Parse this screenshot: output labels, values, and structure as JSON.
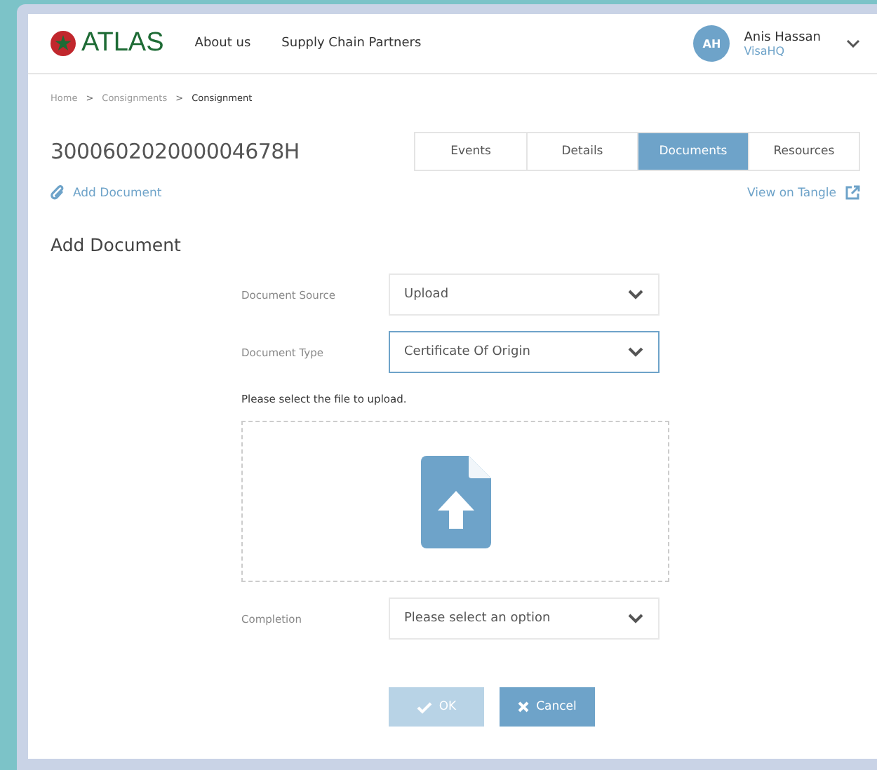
{
  "header": {
    "logo": "ATLAS",
    "nav": [
      "About us",
      "Supply Chain Partners"
    ],
    "user": {
      "initials": "AH",
      "name": "Anis Hassan",
      "org": "VisaHQ"
    }
  },
  "breadcrumb": [
    {
      "label": "Home",
      "current": false
    },
    {
      "label": "Consignments",
      "current": false
    },
    {
      "label": "Consignment",
      "current": true
    }
  ],
  "breadcrumb_separator": ">",
  "consignment_id": "300060202000004678H",
  "tabs": [
    {
      "label": "Events",
      "selected": false
    },
    {
      "label": "Details",
      "selected": false
    },
    {
      "label": "Documents",
      "selected": true
    },
    {
      "label": "Resources",
      "selected": false
    }
  ],
  "add_document_link": "Add Document",
  "tangle_link": "View on Tangle",
  "form": {
    "title": "Add Document",
    "fields": [
      {
        "label": "Document Source",
        "value": "Upload",
        "focused": false
      },
      {
        "label": "Document Type",
        "value": "Certificate Of Origin",
        "focused": true
      }
    ],
    "upload_hint": "Please select the file to upload.",
    "completion": {
      "label": "Completion",
      "placeholder": "Please select an option",
      "focused": false
    },
    "buttons": [
      {
        "label": "OK",
        "kind": "ok",
        "disabled": true
      },
      {
        "label": "Cancel",
        "kind": "cancel",
        "disabled": false
      }
    ]
  }
}
